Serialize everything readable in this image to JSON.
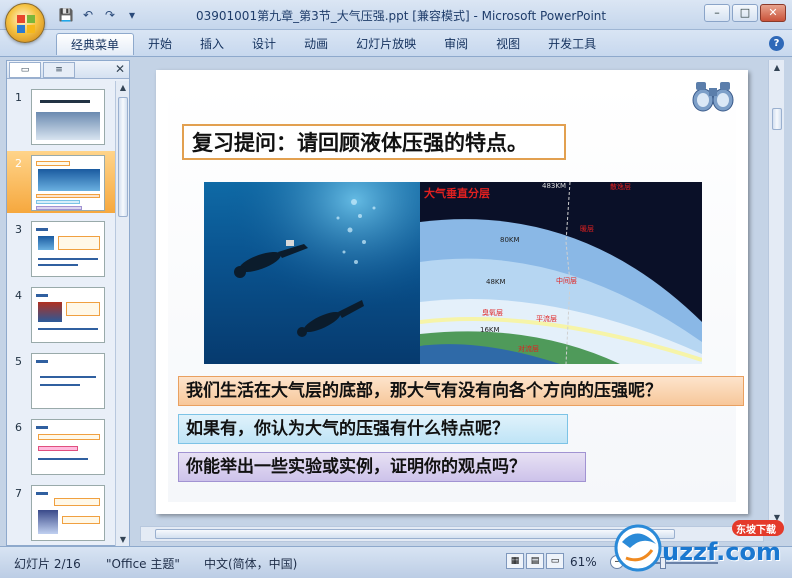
{
  "window": {
    "title": "03901001第九章_第3节_大气压强.ppt [兼容模式] - Microsoft PowerPoint",
    "controls": [
      "–",
      "□",
      "✕"
    ]
  },
  "quick_access": [
    "save-icon",
    "undo-icon",
    "redo-icon",
    "customize-icon"
  ],
  "ribbon": {
    "tabs": [
      "经典菜单",
      "开始",
      "插入",
      "设计",
      "动画",
      "幻灯片放映",
      "审阅",
      "视图",
      "开发工具"
    ],
    "active_tab": "经典菜单",
    "help": "?"
  },
  "slides_pane": {
    "close": "✕",
    "thumbnails": [
      {
        "num": "1"
      },
      {
        "num": "2"
      },
      {
        "num": "3"
      },
      {
        "num": "4"
      },
      {
        "num": "5"
      },
      {
        "num": "6"
      },
      {
        "num": "7"
      }
    ],
    "selected": "2"
  },
  "slide": {
    "question": "复习提问：请回顾液体压强的特点。",
    "atm_image": {
      "title": "大气垂直分层",
      "layers": [
        "散逸层",
        "暖层",
        "中间层",
        "平流层",
        "臭氧层",
        "对流层"
      ],
      "heights": [
        "483KM",
        "80KM",
        "48KM",
        "16KM"
      ]
    },
    "line1": "我们生活在大气层的底部，那大气有没有向各个方向的压强呢？",
    "line2": "如果有，你认为大气的压强有什么特点呢？",
    "line3": "你能举出一些实验或实例，证明你的观点吗？"
  },
  "status": {
    "slide_index": "幻灯片 2/16",
    "theme": "\"Office 主题\"",
    "language": "中文(简体，中国)",
    "zoom": "61%"
  },
  "watermark": {
    "text": "uzzf.com",
    "badge": "东坡下载"
  }
}
